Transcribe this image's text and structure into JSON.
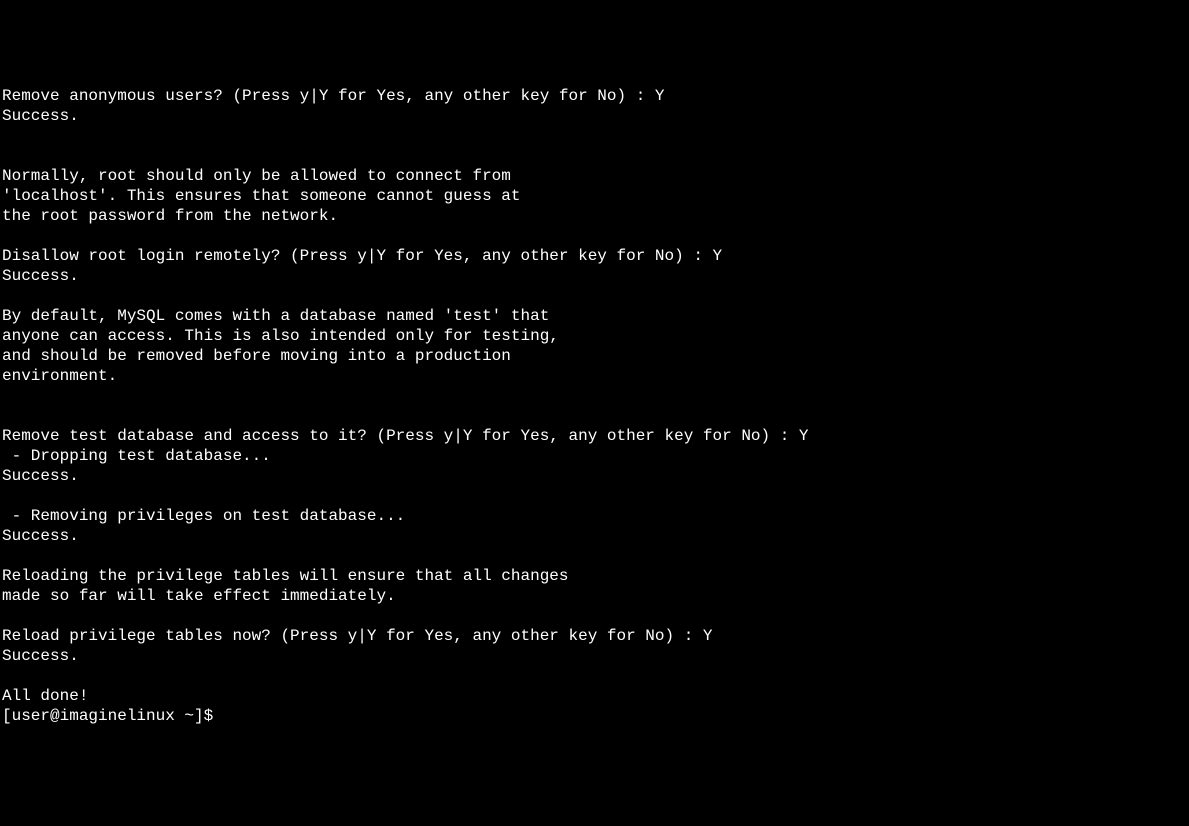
{
  "terminal": {
    "lines": [
      "Remove anonymous users? (Press y|Y for Yes, any other key for No) : Y",
      "Success.",
      "",
      "",
      "Normally, root should only be allowed to connect from",
      "'localhost'. This ensures that someone cannot guess at",
      "the root password from the network.",
      "",
      "Disallow root login remotely? (Press y|Y for Yes, any other key for No) : Y",
      "Success.",
      "",
      "By default, MySQL comes with a database named 'test' that",
      "anyone can access. This is also intended only for testing,",
      "and should be removed before moving into a production",
      "environment.",
      "",
      "",
      "Remove test database and access to it? (Press y|Y for Yes, any other key for No) : Y",
      " - Dropping test database...",
      "Success.",
      "",
      " - Removing privileges on test database...",
      "Success.",
      "",
      "Reloading the privilege tables will ensure that all changes",
      "made so far will take effect immediately.",
      "",
      "Reload privilege tables now? (Press y|Y for Yes, any other key for No) : Y",
      "Success.",
      "",
      "All done!"
    ],
    "prompt": "[user@imaginelinux ~]$ "
  }
}
